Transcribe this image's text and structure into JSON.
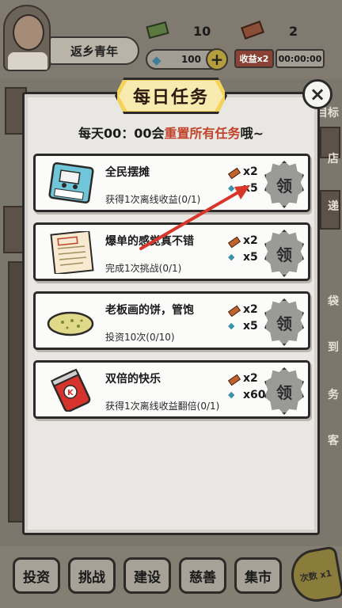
{
  "player": {
    "title": "返乡青年"
  },
  "resources": {
    "cash": "10",
    "bricks": "2",
    "gems": "100",
    "gem_add_label": "+",
    "income_boost_label": "收益x2",
    "boost_timer": "00:00:00"
  },
  "side_labels": [
    "目标",
    "店",
    "递",
    "袋",
    "到",
    "务",
    "客"
  ],
  "bottom_nav": [
    {
      "label": "投资"
    },
    {
      "label": "挑战"
    },
    {
      "label": "建设"
    },
    {
      "label": "慈善"
    },
    {
      "label": "集市"
    }
  ],
  "horn": {
    "label": "次数 x1"
  },
  "modal": {
    "title": "每日任务",
    "close_label": "×",
    "reset_prefix": "每天00：00会",
    "reset_highlight": "重置所有任务",
    "reset_suffix": "哦~",
    "tasks": [
      {
        "name": "全民摆摊",
        "desc": "获得1次离线收益(0/1)",
        "brick_reward": "x2",
        "gem_reward": "x5",
        "claim_label": "领",
        "image": "stall-license-icon"
      },
      {
        "name": "爆单的感觉真不错",
        "desc": "完成1次挑战(0/1)",
        "brick_reward": "x2",
        "gem_reward": "x5",
        "claim_label": "领",
        "image": "order-form-icon"
      },
      {
        "name": "老板画的饼，管饱",
        "desc": "投资10次(0/10)",
        "brick_reward": "x2",
        "gem_reward": "x5",
        "claim_label": "领",
        "image": "pancake-icon"
      },
      {
        "name": "双倍的快乐",
        "desc": "获得1次离线收益翻倍(0/1)",
        "brick_reward": "x2",
        "gem_reward": "x60",
        "claim_label": "领",
        "image": "soda-can-icon"
      }
    ]
  },
  "colors": {
    "header_yellow": "#f3d35a",
    "highlight_red": "#c2432a",
    "arrow_red": "#d8362a"
  }
}
